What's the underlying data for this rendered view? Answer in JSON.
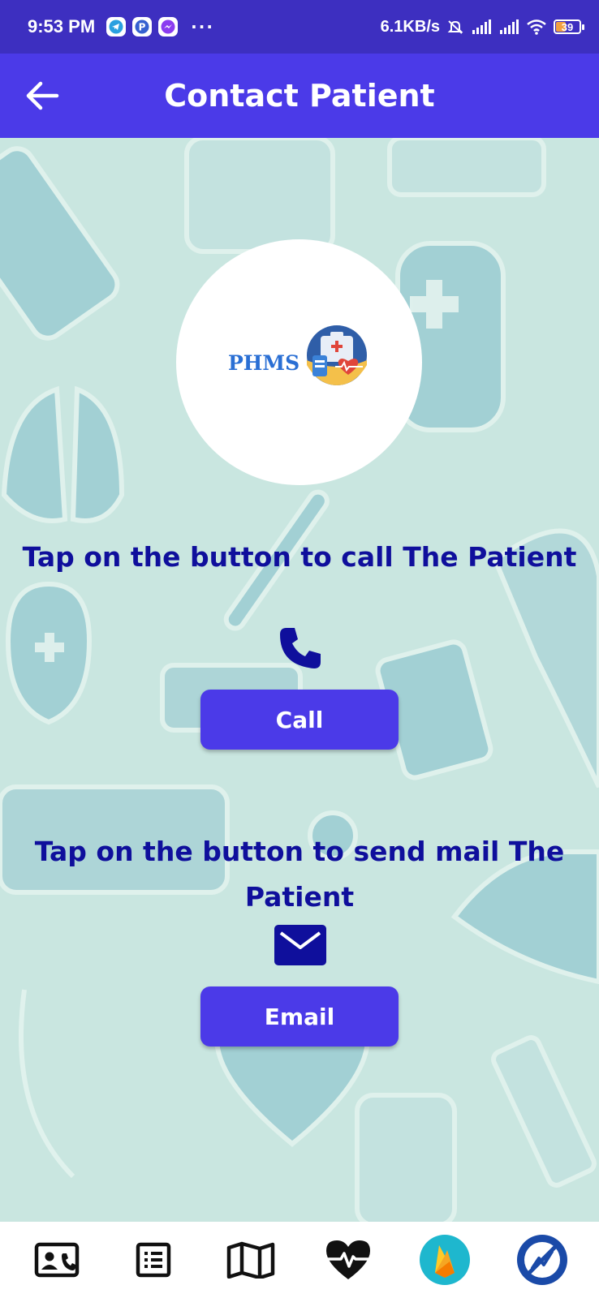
{
  "status_bar": {
    "time": "9:53 PM",
    "dots": "···",
    "network_speed": "6.1KB/s",
    "battery": "39",
    "icons": [
      "telegram-icon",
      "pinterest-icon",
      "messenger-icon",
      "mute-icon",
      "signal-icon",
      "signal-icon",
      "wifi-icon",
      "battery-icon"
    ]
  },
  "app_bar": {
    "title": "Contact Patient",
    "back_icon": "arrow-left-icon"
  },
  "logo": {
    "text": "PHMS"
  },
  "call_section": {
    "heading": "Tap on the button to call The Patient",
    "icon": "phone-icon",
    "button_label": "Call"
  },
  "email_section": {
    "heading": "Tap on the button to send mail The Patient",
    "icon": "mail-icon",
    "button_label": "Email"
  },
  "bottom_nav": {
    "items": [
      "contact-card-icon",
      "list-icon",
      "map-icon",
      "heartbeat-icon",
      "firebase-icon",
      "analytics-icon"
    ]
  },
  "colors": {
    "status_bar": "#3d2fc0",
    "app_bar": "#4b3ae8",
    "button": "#4b3ae8",
    "heading_text": "#0f0f9c",
    "background": "#c9e6e0"
  }
}
